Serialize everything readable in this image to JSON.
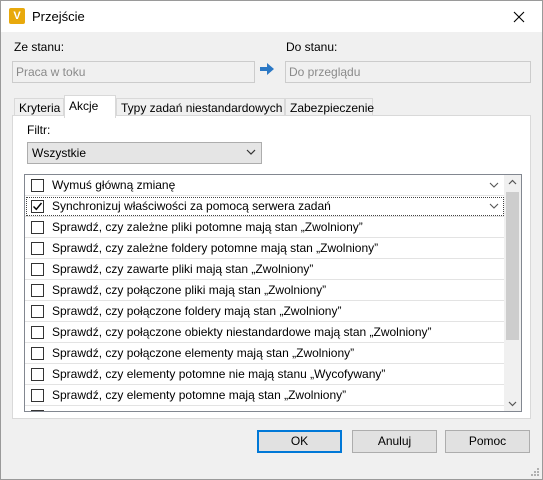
{
  "window": {
    "title": "Przejście",
    "app_icon_letter": "V"
  },
  "states": {
    "from_label": "Ze stanu:",
    "from_value": "Praca w toku",
    "to_label": "Do stanu:",
    "to_value": "Do przeglądu"
  },
  "tabs": [
    {
      "label": "Kryteria",
      "active": false
    },
    {
      "label": "Akcje",
      "active": true
    },
    {
      "label": "Typy zadań niestandardowych",
      "active": false
    },
    {
      "label": "Zabezpieczenie",
      "active": false
    }
  ],
  "filter": {
    "label": "Filtr:",
    "selected": "Wszystkie"
  },
  "actions": [
    {
      "label": "Wymuś główną zmianę",
      "checked": false,
      "expandable": true
    },
    {
      "label": "Synchronizuj właściwości za pomocą serwera zadań",
      "checked": true,
      "expandable": true
    },
    {
      "label": "Sprawdź, czy zależne pliki potomne mają stan „Zwolniony”",
      "checked": false,
      "expandable": false
    },
    {
      "label": "Sprawdź, czy zależne foldery potomne mają stan „Zwolniony”",
      "checked": false,
      "expandable": false
    },
    {
      "label": "Sprawdź, czy zawarte pliki mają stan „Zwolniony”",
      "checked": false,
      "expandable": false
    },
    {
      "label": "Sprawdź, czy połączone pliki mają stan „Zwolniony”",
      "checked": false,
      "expandable": false
    },
    {
      "label": "Sprawdź, czy połączone foldery mają stan „Zwolniony”",
      "checked": false,
      "expandable": false
    },
    {
      "label": "Sprawdź, czy połączone obiekty niestandardowe mają stan „Zwolniony”",
      "checked": false,
      "expandable": false
    },
    {
      "label": "Sprawdź, czy połączone elementy mają stan „Zwolniony”",
      "checked": false,
      "expandable": false
    },
    {
      "label": "Sprawdź, czy elementy potomne nie mają stanu „Wycofywany”",
      "checked": false,
      "expandable": false
    },
    {
      "label": "Sprawdź, czy elementy potomne mają stan „Zwolniony”",
      "checked": false,
      "expandable": false
    },
    {
      "label": "",
      "checked": false,
      "expandable": false
    }
  ],
  "buttons": {
    "ok": "OK",
    "cancel": "Anuluj",
    "help": "Pomoc"
  },
  "colors": {
    "accent": "#0078d7",
    "app_icon": "#e8a90c",
    "arrow": "#2b78c5"
  }
}
